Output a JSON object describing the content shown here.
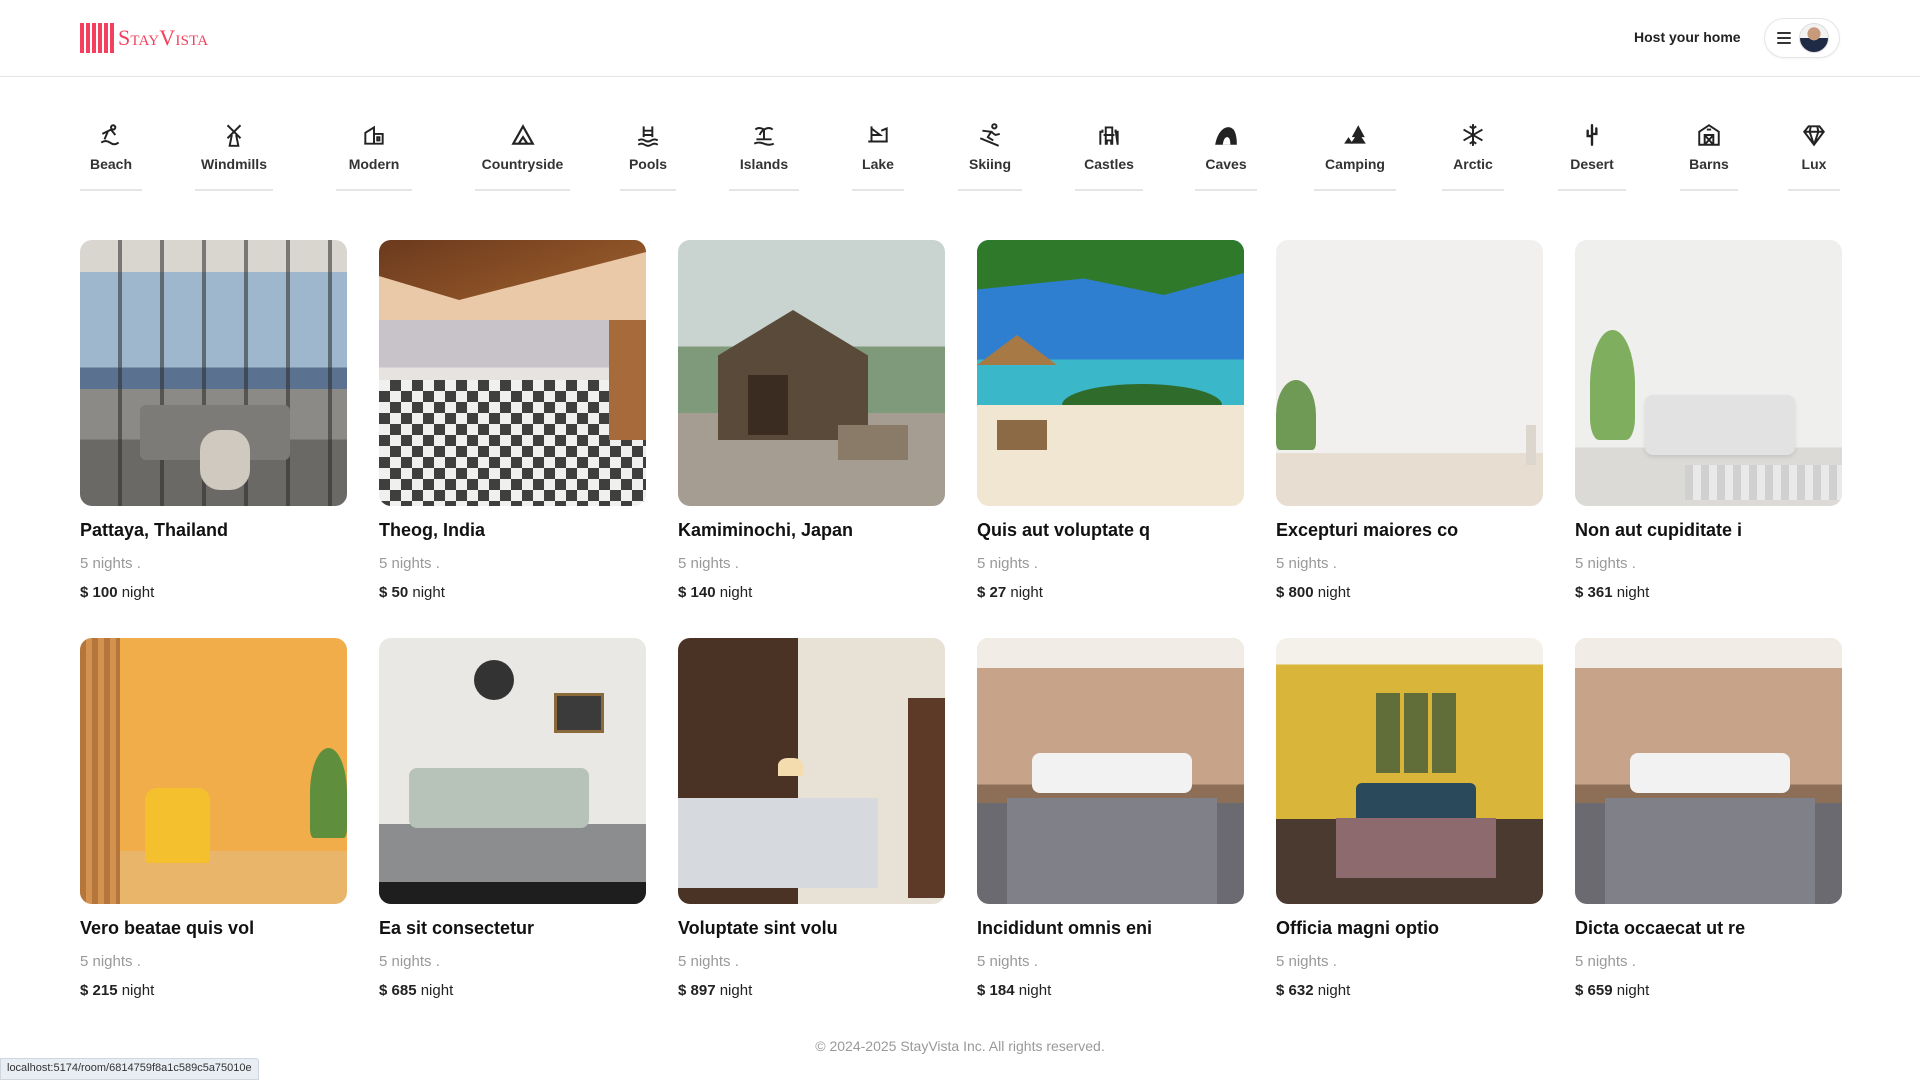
{
  "header": {
    "logo_text": "StayVista",
    "host_label": "Host your home"
  },
  "categories": [
    {
      "label": "Beach",
      "icon": "beach-icon"
    },
    {
      "label": "Windmills",
      "icon": "windmill-icon"
    },
    {
      "label": "Modern",
      "icon": "modern-house-icon"
    },
    {
      "label": "Countryside",
      "icon": "mountain-icon"
    },
    {
      "label": "Pools",
      "icon": "pool-icon"
    },
    {
      "label": "Islands",
      "icon": "island-icon"
    },
    {
      "label": "Lake",
      "icon": "boat-icon"
    },
    {
      "label": "Skiing",
      "icon": "skiing-icon"
    },
    {
      "label": "Castles",
      "icon": "castle-icon"
    },
    {
      "label": "Caves",
      "icon": "cave-icon"
    },
    {
      "label": "Camping",
      "icon": "camping-icon"
    },
    {
      "label": "Arctic",
      "icon": "snowflake-icon"
    },
    {
      "label": "Desert",
      "icon": "cactus-icon"
    },
    {
      "label": "Barns",
      "icon": "barn-icon"
    },
    {
      "label": "Lux",
      "icon": "diamond-icon"
    }
  ],
  "listings": [
    {
      "title": "Pattaya, Thailand",
      "nights": "5 nights .",
      "price": "$ 100",
      "unit": "night"
    },
    {
      "title": "Theog, India",
      "nights": "5 nights .",
      "price": "$ 50",
      "unit": "night"
    },
    {
      "title": "Kamiminochi, Japan",
      "nights": "5 nights .",
      "price": "$ 140",
      "unit": "night"
    },
    {
      "title": "Quis aut voluptate q",
      "nights": "5 nights .",
      "price": "$ 27",
      "unit": "night"
    },
    {
      "title": "Excepturi maiores co",
      "nights": "5 nights .",
      "price": "$ 800",
      "unit": "night"
    },
    {
      "title": "Non aut cupiditate i",
      "nights": "5 nights .",
      "price": "$ 361",
      "unit": "night"
    },
    {
      "title": "Vero beatae quis vol",
      "nights": "5 nights .",
      "price": "$ 215",
      "unit": "night"
    },
    {
      "title": "Ea sit consectetur",
      "nights": "5 nights .",
      "price": "$ 685",
      "unit": "night"
    },
    {
      "title": "Voluptate sint volu",
      "nights": "5 nights .",
      "price": "$ 897",
      "unit": "night"
    },
    {
      "title": "Incididunt omnis eni",
      "nights": "5 nights .",
      "price": "$ 184",
      "unit": "night"
    },
    {
      "title": "Officia magni optio",
      "nights": "5 nights .",
      "price": "$ 632",
      "unit": "night"
    },
    {
      "title": "Dicta occaecat ut re",
      "nights": "5 nights .",
      "price": "$ 659",
      "unit": "night"
    }
  ],
  "footer": {
    "copyright": "© 2024-2025 StayVista Inc. All rights reserved."
  },
  "status_bar": {
    "url": "localhost:5174/room/6814759f8a1c589c5a75010e"
  },
  "colors": {
    "brand": "#f43f5e"
  }
}
